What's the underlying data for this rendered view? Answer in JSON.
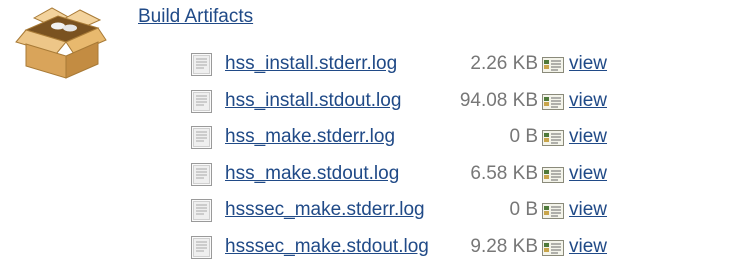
{
  "section": {
    "title": "Build Artifacts",
    "icon": "package-box-icon"
  },
  "colors": {
    "link": "#204a87",
    "size_text": "#777777",
    "box_body": "#d9a45a",
    "box_flap": "#edc688"
  },
  "artifacts": [
    {
      "name": "hss_install.stderr.log",
      "size": "2.26 KB",
      "view_label": "view",
      "icon": "text-file-icon",
      "view_icon": "view-doc-icon"
    },
    {
      "name": "hss_install.stdout.log",
      "size": "94.08 KB",
      "view_label": "view",
      "icon": "text-file-icon",
      "view_icon": "view-doc-icon"
    },
    {
      "name": "hss_make.stderr.log",
      "size": "0 B",
      "view_label": "view",
      "icon": "text-file-icon",
      "view_icon": "view-doc-icon"
    },
    {
      "name": "hss_make.stdout.log",
      "size": "6.58 KB",
      "view_label": "view",
      "icon": "text-file-icon",
      "view_icon": "view-doc-icon"
    },
    {
      "name": "hsssec_make.stderr.log",
      "size": "0 B",
      "view_label": "view",
      "icon": "text-file-icon",
      "view_icon": "view-doc-icon"
    },
    {
      "name": "hsssec_make.stdout.log",
      "size": "9.28 KB",
      "view_label": "view",
      "icon": "text-file-icon",
      "view_icon": "view-doc-icon"
    }
  ]
}
